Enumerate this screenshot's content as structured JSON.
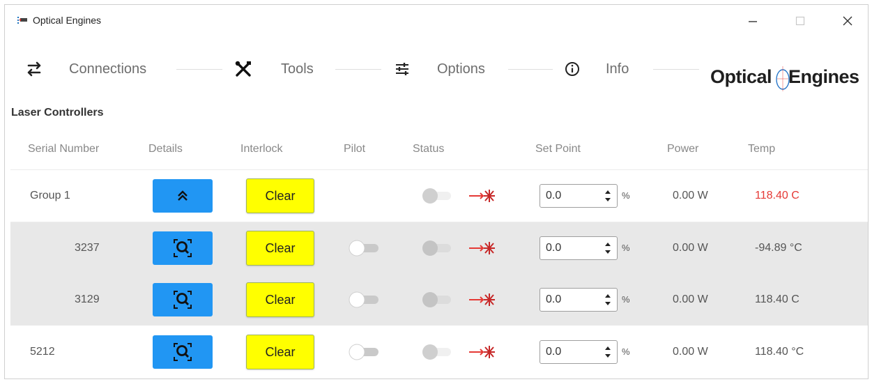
{
  "window": {
    "title": "Optical Engines",
    "controls": {
      "minimize": "—",
      "maximize": "☐",
      "close": "✕"
    }
  },
  "toolbar": {
    "items": [
      {
        "label": "Connections",
        "icon": "connections-icon"
      },
      {
        "label": "Tools",
        "icon": "tools-icon"
      },
      {
        "label": "Options",
        "icon": "sliders-icon"
      },
      {
        "label": "Info",
        "icon": "info-icon"
      }
    ]
  },
  "logo": {
    "left": "Optical",
    "right": "Engines"
  },
  "section_title": "Laser Controllers",
  "table": {
    "columns": [
      "Serial Number",
      "Details",
      "Interlock",
      "Pilot",
      "Status",
      "Set Point",
      "Power",
      "Temp"
    ],
    "rows": [
      {
        "serial": "Group 1",
        "details_icon": "collapse-up-icon",
        "interlock": "Clear",
        "pilot_on": null,
        "status_on": false,
        "set_point": "0.0",
        "unit": "%",
        "power": "0.00 W",
        "temp": "118.40 C",
        "temp_alert": true
      },
      {
        "serial": "3237",
        "details_icon": "zoom-icon",
        "interlock": "Clear",
        "pilot_on": false,
        "status_on": false,
        "set_point": "0.0",
        "unit": "%",
        "power": "0.00 W",
        "temp": "-94.89 °C",
        "temp_alert": false
      },
      {
        "serial": "3129",
        "details_icon": "zoom-icon",
        "interlock": "Clear",
        "pilot_on": false,
        "status_on": false,
        "set_point": "0.0",
        "unit": "%",
        "power": "0.00 W",
        "temp": "118.40 C",
        "temp_alert": false
      },
      {
        "serial": "5212",
        "details_icon": "zoom-icon",
        "interlock": "Clear",
        "pilot_on": false,
        "status_on": false,
        "set_point": "0.0",
        "unit": "%",
        "power": "0.00 W",
        "temp": "118.40 °C",
        "temp_alert": false
      }
    ]
  },
  "colors": {
    "details_button": "#2196f3",
    "interlock_button": "#ffff00",
    "temp_alert": "#e53935",
    "laser_off": "#e53935",
    "row_alt": "#e8e8e8"
  }
}
